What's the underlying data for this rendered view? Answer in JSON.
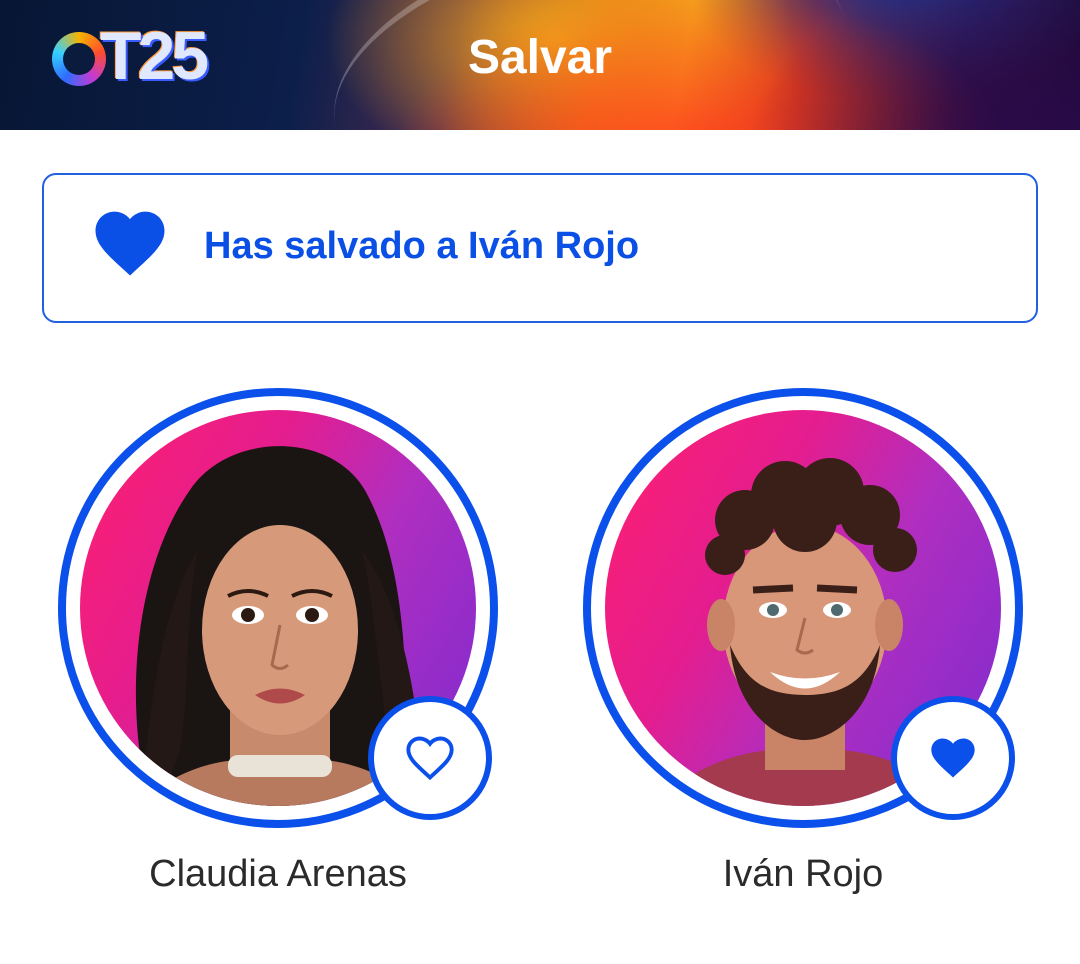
{
  "header": {
    "logo_text": "OT25",
    "title": "Salvar"
  },
  "notice": {
    "icon": "heart-filled-icon",
    "message": "Has salvado a Iván Rojo",
    "accent_color": "#0a4fe6"
  },
  "candidates": [
    {
      "name": "Claudia Arenas",
      "favorite": false,
      "icon": "heart-outline-icon"
    },
    {
      "name": "Iván Rojo",
      "favorite": true,
      "icon": "heart-filled-icon"
    }
  ],
  "colors": {
    "primary": "#0b50ea",
    "text": "#2b2b2b",
    "photo_bg_start": "#ff1f6e",
    "photo_bg_end": "#7d2bd0"
  }
}
